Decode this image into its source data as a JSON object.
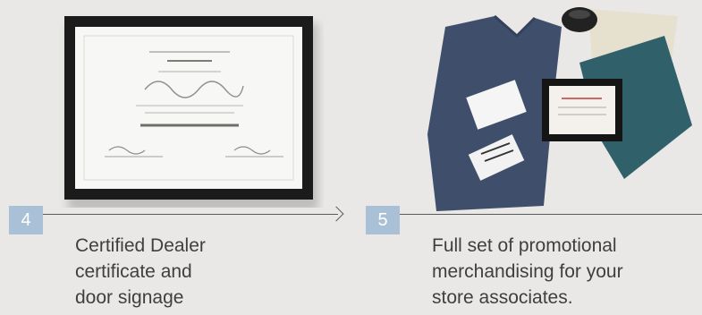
{
  "steps": [
    {
      "number": "4",
      "caption": "Certified Dealer\ncertificate and\ndoor signage",
      "image": "certified-dealer-certificate-image"
    },
    {
      "number": "5",
      "caption": "Full set of promotional\nmerchandising for your\nstore associates.",
      "image": "promotional-merchandise-image"
    }
  ],
  "colors": {
    "background": "#e9e8e6",
    "badge": "#a9c0d6",
    "text": "#3f3f3f",
    "line": "#5a5a5a"
  }
}
